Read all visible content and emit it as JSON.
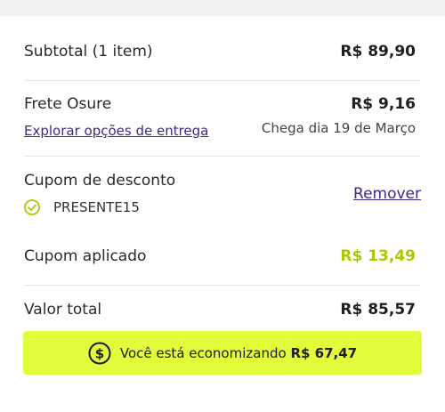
{
  "summary": {
    "subtotal_label": "Subtotal (1 item)",
    "subtotal_value": "R$ 89,90",
    "shipping_label": "Frete Osure",
    "shipping_value": "R$ 9,16",
    "shipping_link": "Explorar opções de entrega",
    "shipping_eta": "Chega dia 19 de Março",
    "coupon_label": "Cupom de desconto",
    "coupon_code": "PRESENTE15",
    "coupon_remove": "Remover",
    "coupon_applied_label": "Cupom aplicado",
    "coupon_applied_value": "R$ 13,49",
    "total_label": "Valor total",
    "total_value": "R$ 85,57"
  },
  "savings": {
    "text": "Você está economizando",
    "amount": "R$ 67,47",
    "icon": "dollar-coin-icon"
  },
  "colors": {
    "accent": "#e2fb3a",
    "success": "#a8c900",
    "link": "#3b2a8c"
  }
}
